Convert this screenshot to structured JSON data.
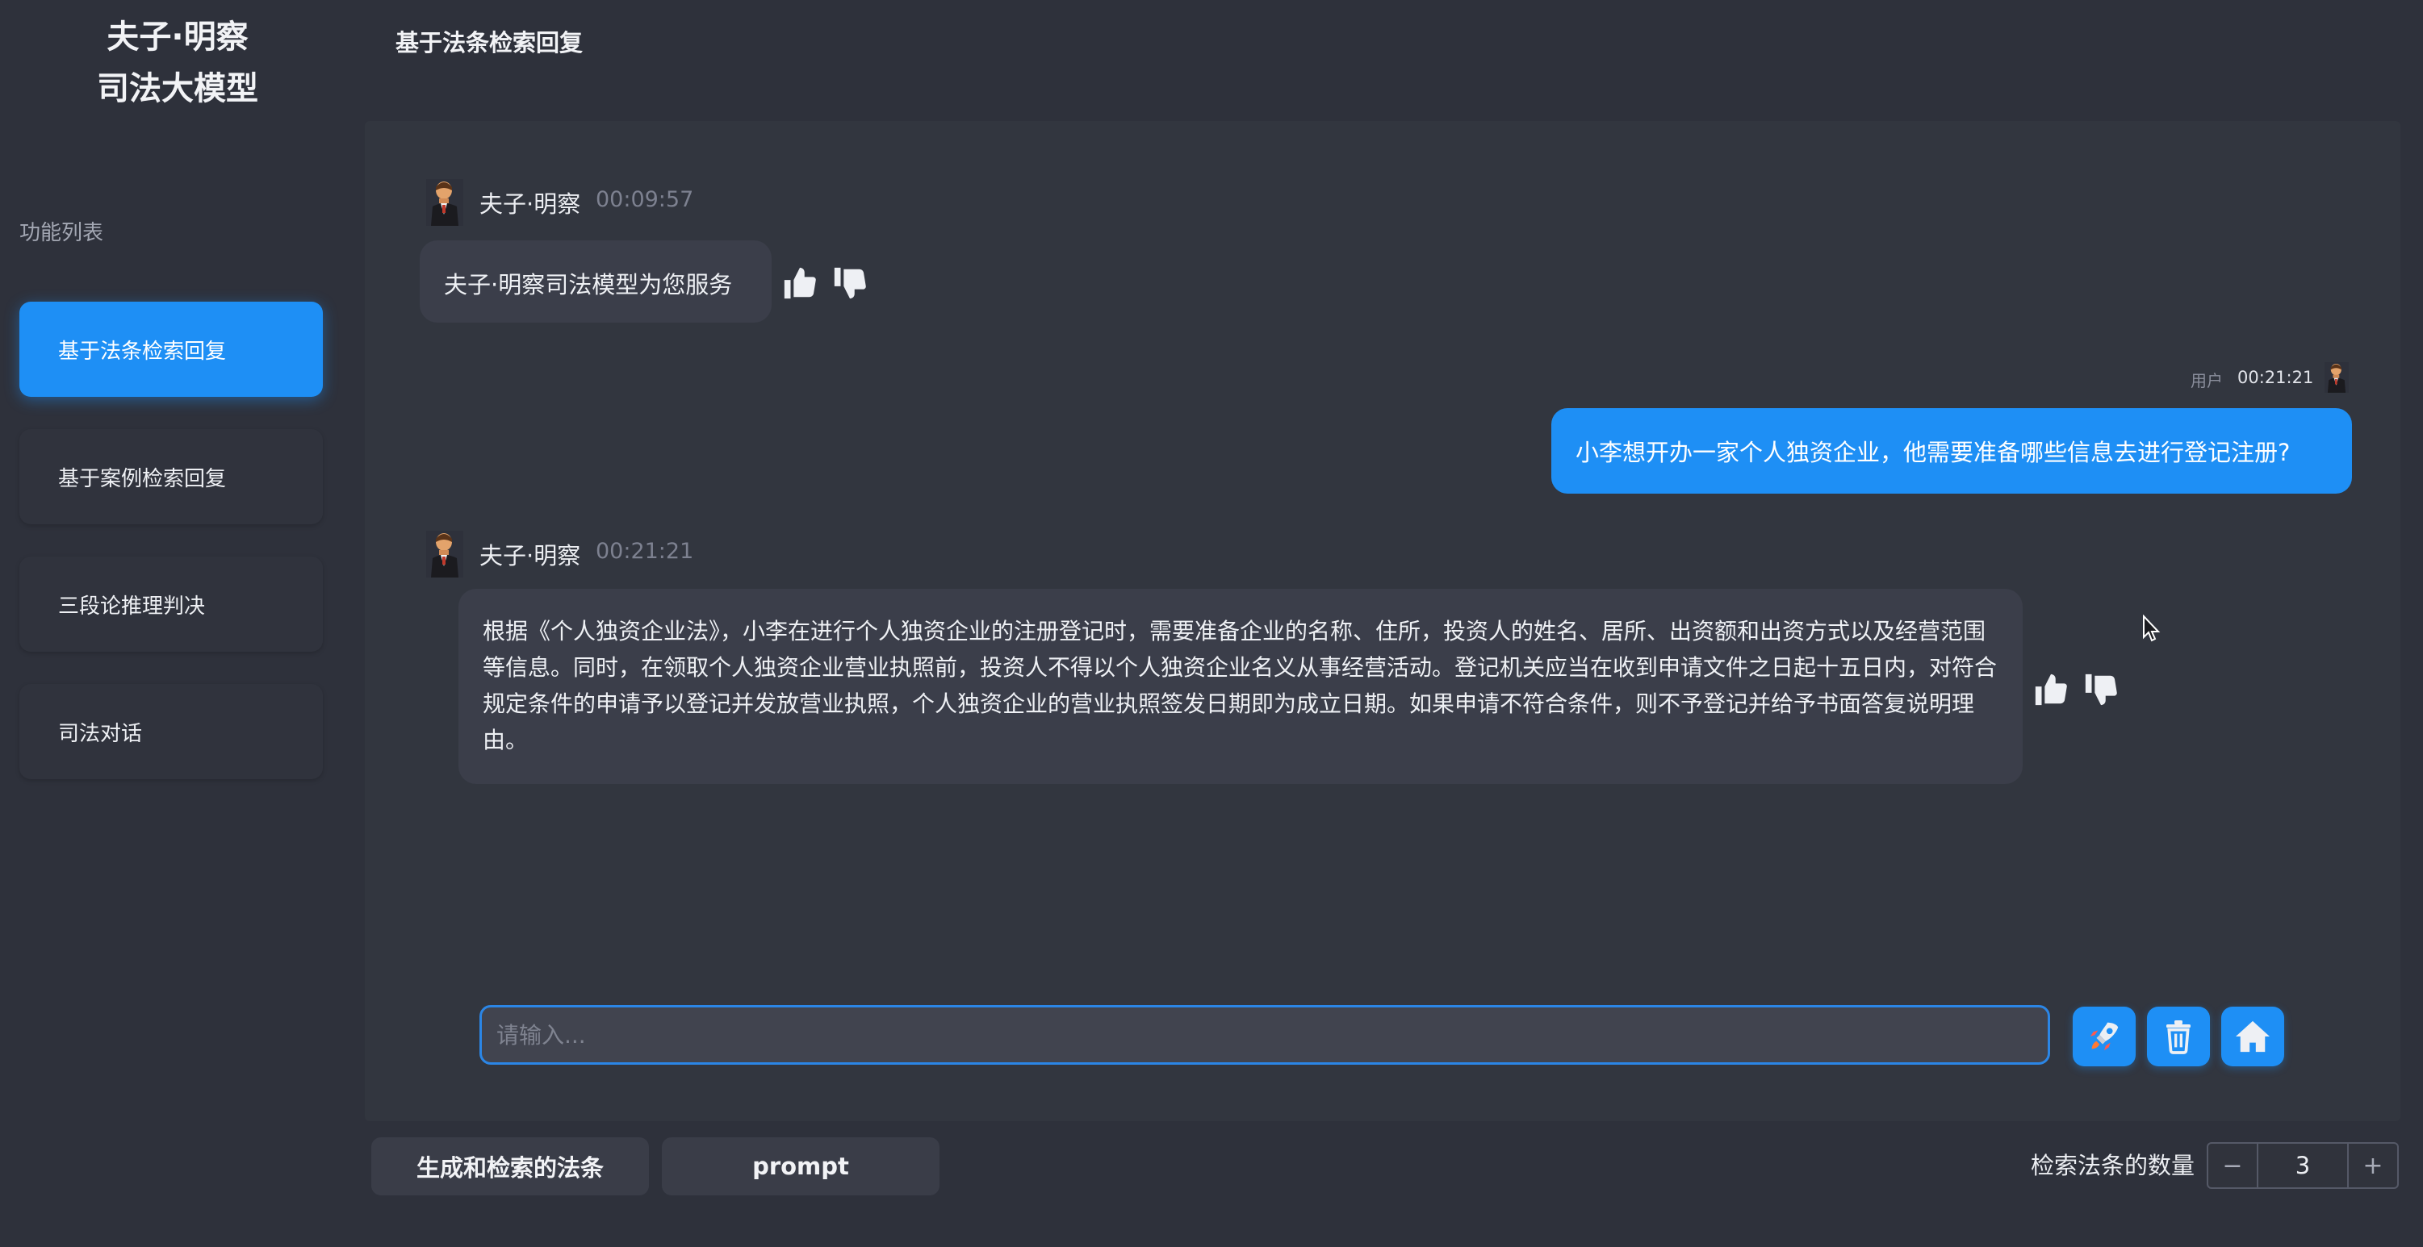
{
  "brand": {
    "line1": "夫子·明察",
    "line2": "司法大模型"
  },
  "sidebar": {
    "heading": "功能列表",
    "items": [
      {
        "label": "基于法条检索回复",
        "active": true
      },
      {
        "label": "基于案例检索回复",
        "active": false
      },
      {
        "label": "三段论推理判决",
        "active": false
      },
      {
        "label": "司法对话",
        "active": false
      }
    ]
  },
  "header": {
    "title": "基于法条检索回复"
  },
  "chat": {
    "messages": [
      {
        "role": "bot",
        "name": "夫子·明察",
        "time": "00:09:57",
        "text": "夫子·明察司法模型为您服务"
      },
      {
        "role": "user",
        "name": "用户",
        "time": "00:21:21",
        "text": "小李想开办一家个人独资企业，他需要准备哪些信息去进行登记注册?"
      },
      {
        "role": "bot",
        "name": "夫子·明察",
        "time": "00:21:21",
        "text": "根据《个人独资企业法》，小李在进行个人独资企业的注册登记时，需要准备企业的名称、住所，投资人的姓名、居所、出资额和出资方式以及经营范围等信息。同时，在领取个人独资企业营业执照前，投资人不得以个人独资企业名义从事经营活动。登记机关应当在收到申请文件之日起十五日内，对符合规定条件的申请予以登记并发放营业执照，个人独资企业的营业执照签发日期即为成立日期。如果申请不符合条件，则不予登记并给予书面答复说明理由。"
      }
    ]
  },
  "input": {
    "placeholder": "请输入...",
    "value": ""
  },
  "actions": {
    "send_icon": "rocket-icon",
    "clear_icon": "trash-icon",
    "home_icon": "home-icon"
  },
  "bottom": {
    "laws_button": "生成和检索的法条",
    "prompt_button": "prompt",
    "count_label": "检索法条的数量",
    "count_value": "3",
    "minus": "−",
    "plus": "+"
  },
  "colors": {
    "accent": "#1e8ff5",
    "background": "#2e313b",
    "panel": "#32363f",
    "bubble": "#3b3e4a"
  }
}
